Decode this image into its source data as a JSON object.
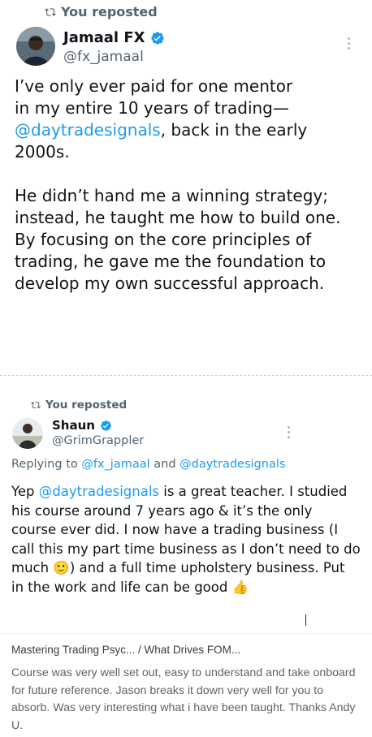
{
  "post1": {
    "repost_label": "You reposted",
    "author_name": "Jamaal FX",
    "author_handle": "@fx_jamaal",
    "text_line1_a": "I’ve only ever paid for one mentor",
    "text_line2_a": "in my entire 10 years of trading—",
    "mention": "@daytradesignals",
    "text_line3_rest": ", back in the early",
    "text_line4": "2000s.",
    "paragraph2": "He didn’t hand me a winning strategy; instead, he taught me how to build one. By focusing on the core principles of trading, he gave me the foundation to develop my own successful approach."
  },
  "post2": {
    "repost_label": "You reposted",
    "author_name": "Shaun",
    "author_handle": "@GrimGrappler",
    "replying_prefix": "Replying to ",
    "replying_user1": "@fx_jamaal",
    "replying_and": " and ",
    "replying_user2": "@daytradesignals",
    "text_start": "Yep ",
    "text_mention": "@daytradesignals",
    "text_rest": " is a great teacher. I studied his course around 7 years ago & it’s the only course ever did. I now have a trading business (I call this my part time business as I don’t need to do much ",
    "emoji_smile": "🙂",
    "text_rest2": ") and a full time upholstery business. Put in the work and life can be good ",
    "emoji_thumb": "👍"
  },
  "review": {
    "breadcrumb": "Mastering Trading Psyc...  /  What Drives FOM...",
    "body": "Course was very well set out, easy to understand and take onboard for future reference. Jason breaks it down very well for you to absorb. Was very interesting what i have been taught. Thanks Andy U."
  },
  "colors": {
    "accent": "#1d9bf0",
    "secondary_text": "#536471"
  },
  "icons": [
    "repost-icon",
    "verified-badge-icon",
    "more-options-icon"
  ]
}
